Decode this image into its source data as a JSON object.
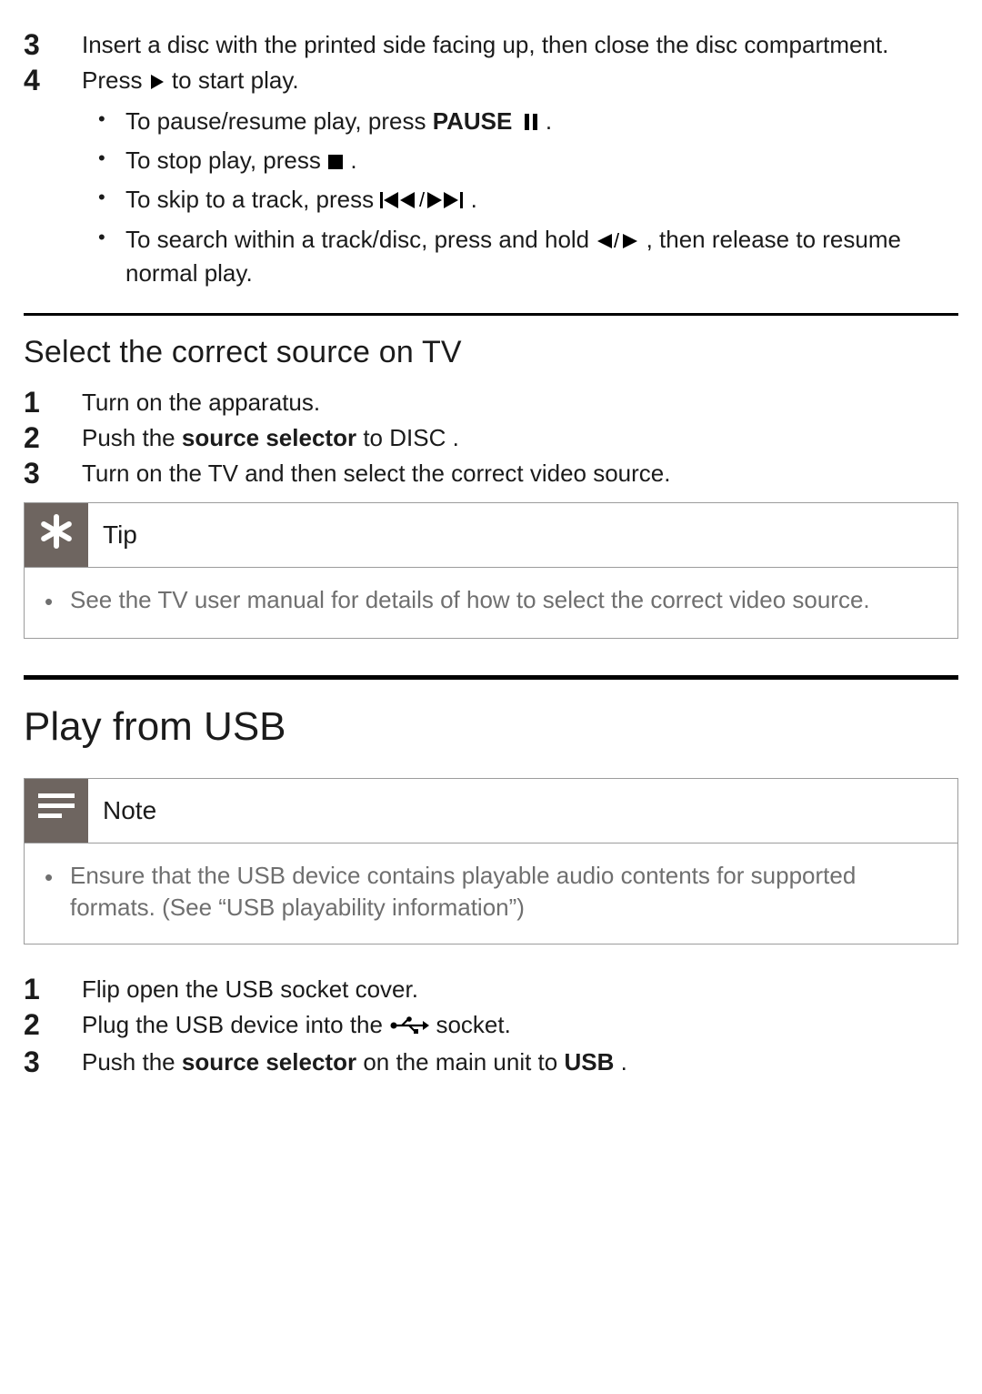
{
  "top_steps": [
    {
      "n": "3",
      "text": "Insert a disc with the printed side facing up, then close the disc compartment."
    },
    {
      "n": "4",
      "text_before": "Press ",
      "text_after": " to start play.",
      "subs": [
        {
          "before": "To pause/resume play, press ",
          "bold": "PAUSE",
          "after": ".",
          "icon": "pause"
        },
        {
          "before": "To stop play, press ",
          "after": ".",
          "icon": "stop"
        },
        {
          "before": "To skip to a track, press ",
          "after": ".",
          "icon": "skip"
        },
        {
          "before": "To search within a track/disc, press and hold  ",
          "after": ", then release to resume normal play.",
          "icon": "seek"
        }
      ]
    }
  ],
  "section_tv": {
    "heading": "Select the correct source on TV",
    "steps": [
      {
        "n": "1",
        "text": "Turn on the apparatus."
      },
      {
        "n": "2",
        "before": "Push the ",
        "bold1": "source selector",
        "mid": " to ",
        "bold2": "DISC",
        "after": "."
      },
      {
        "n": "3",
        "text": "Turn on the TV and then select the correct video source."
      }
    ]
  },
  "tip": {
    "label": "Tip",
    "text": "See the TV user manual for details of how to select the correct video source."
  },
  "section_usb": {
    "heading": "Play from USB"
  },
  "note": {
    "label": "Note",
    "text": "Ensure that the USB device contains playable audio contents for supported formats. (See “USB playability information”)"
  },
  "usb_steps": [
    {
      "n": "1",
      "text": "Flip open the USB socket cover."
    },
    {
      "n": "2",
      "before": "Plug the USB device into the ",
      "after": " socket.",
      "icon": "usb"
    },
    {
      "n": "3",
      "before": "Push the ",
      "bold1": "source selector",
      "mid": " on the main unit to ",
      "bold2": "USB",
      "after": "."
    }
  ]
}
